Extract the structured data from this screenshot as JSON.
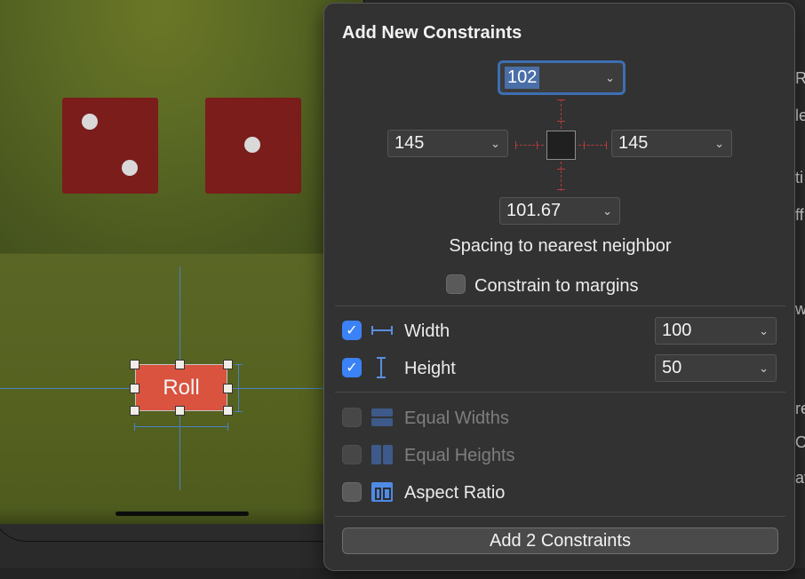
{
  "canvas": {
    "button_label": "Roll"
  },
  "popover": {
    "title": "Add New Constraints",
    "spacing": {
      "top": "102",
      "left": "145",
      "right": "145",
      "bottom": "101.67",
      "caption": "Spacing to nearest neighbor"
    },
    "constrain_to_margins": {
      "label": "Constrain to margins",
      "checked": false
    },
    "width": {
      "label": "Width",
      "value": "100",
      "checked": true
    },
    "height": {
      "label": "Height",
      "value": "50",
      "checked": true
    },
    "equal_widths": {
      "label": "Equal Widths",
      "checked": false,
      "enabled": false
    },
    "equal_heights": {
      "label": "Equal Heights",
      "checked": false,
      "enabled": false
    },
    "aspect_ratio": {
      "label": "Aspect Ratio",
      "checked": false
    },
    "add_button": "Add 2 Constraints",
    "accent_color": "#3b82f6",
    "strut_color": "#b83b3b"
  },
  "inspector_peek": [
    "R",
    "le",
    "ti",
    "ff",
    "w",
    "re",
    "Or",
    "av"
  ]
}
